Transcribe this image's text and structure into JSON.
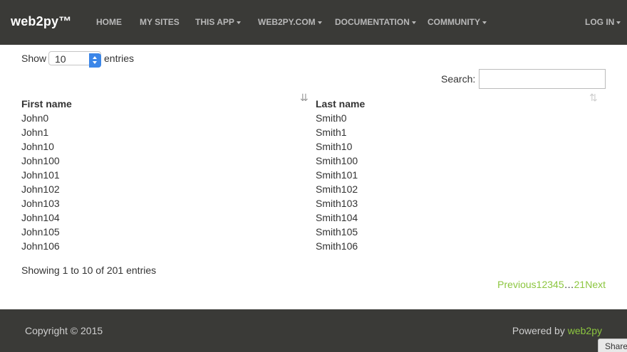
{
  "navbar": {
    "brand": "web2py™",
    "items": [
      {
        "label": "HOME",
        "dropdown": false
      },
      {
        "label": "MY SITES",
        "dropdown": false
      },
      {
        "label": "THIS APP",
        "dropdown": true
      },
      {
        "label": "WEB2PY.COM",
        "dropdown": true
      },
      {
        "label": "DOCUMENTATION",
        "dropdown": true
      },
      {
        "label": "COMMUNITY",
        "dropdown": true
      },
      {
        "label": "LOG IN",
        "dropdown": true
      }
    ]
  },
  "length_control": {
    "prefix": "Show",
    "value": "10",
    "suffix": "entries"
  },
  "search": {
    "label": "Search:",
    "value": ""
  },
  "table": {
    "columns": [
      "First name",
      "Last name"
    ],
    "rows": [
      [
        "John0",
        "Smith0"
      ],
      [
        "John1",
        "Smith1"
      ],
      [
        "John10",
        "Smith10"
      ],
      [
        "John100",
        "Smith100"
      ],
      [
        "John101",
        "Smith101"
      ],
      [
        "John102",
        "Smith102"
      ],
      [
        "John103",
        "Smith103"
      ],
      [
        "John104",
        "Smith104"
      ],
      [
        "John105",
        "Smith105"
      ],
      [
        "John106",
        "Smith106"
      ]
    ]
  },
  "info": "Showing 1 to 10 of 201 entries",
  "pagination": {
    "previous": "Previous",
    "pages": [
      "1",
      "2",
      "3",
      "4",
      "5"
    ],
    "ellipsis": "…",
    "last": "21",
    "next": "Next"
  },
  "footer": {
    "copyright": "Copyright © 2015",
    "powered_prefix": "Powered by",
    "powered_brand": "web2py"
  },
  "share_label": "Share",
  "icons": {
    "sort_asc": "sort-ascending-icon",
    "sort_both": "sort-both-icon"
  },
  "colors": {
    "navbar": "#3a3a37",
    "link": "#8cc63f",
    "select_arrow": "#3b86e8"
  }
}
